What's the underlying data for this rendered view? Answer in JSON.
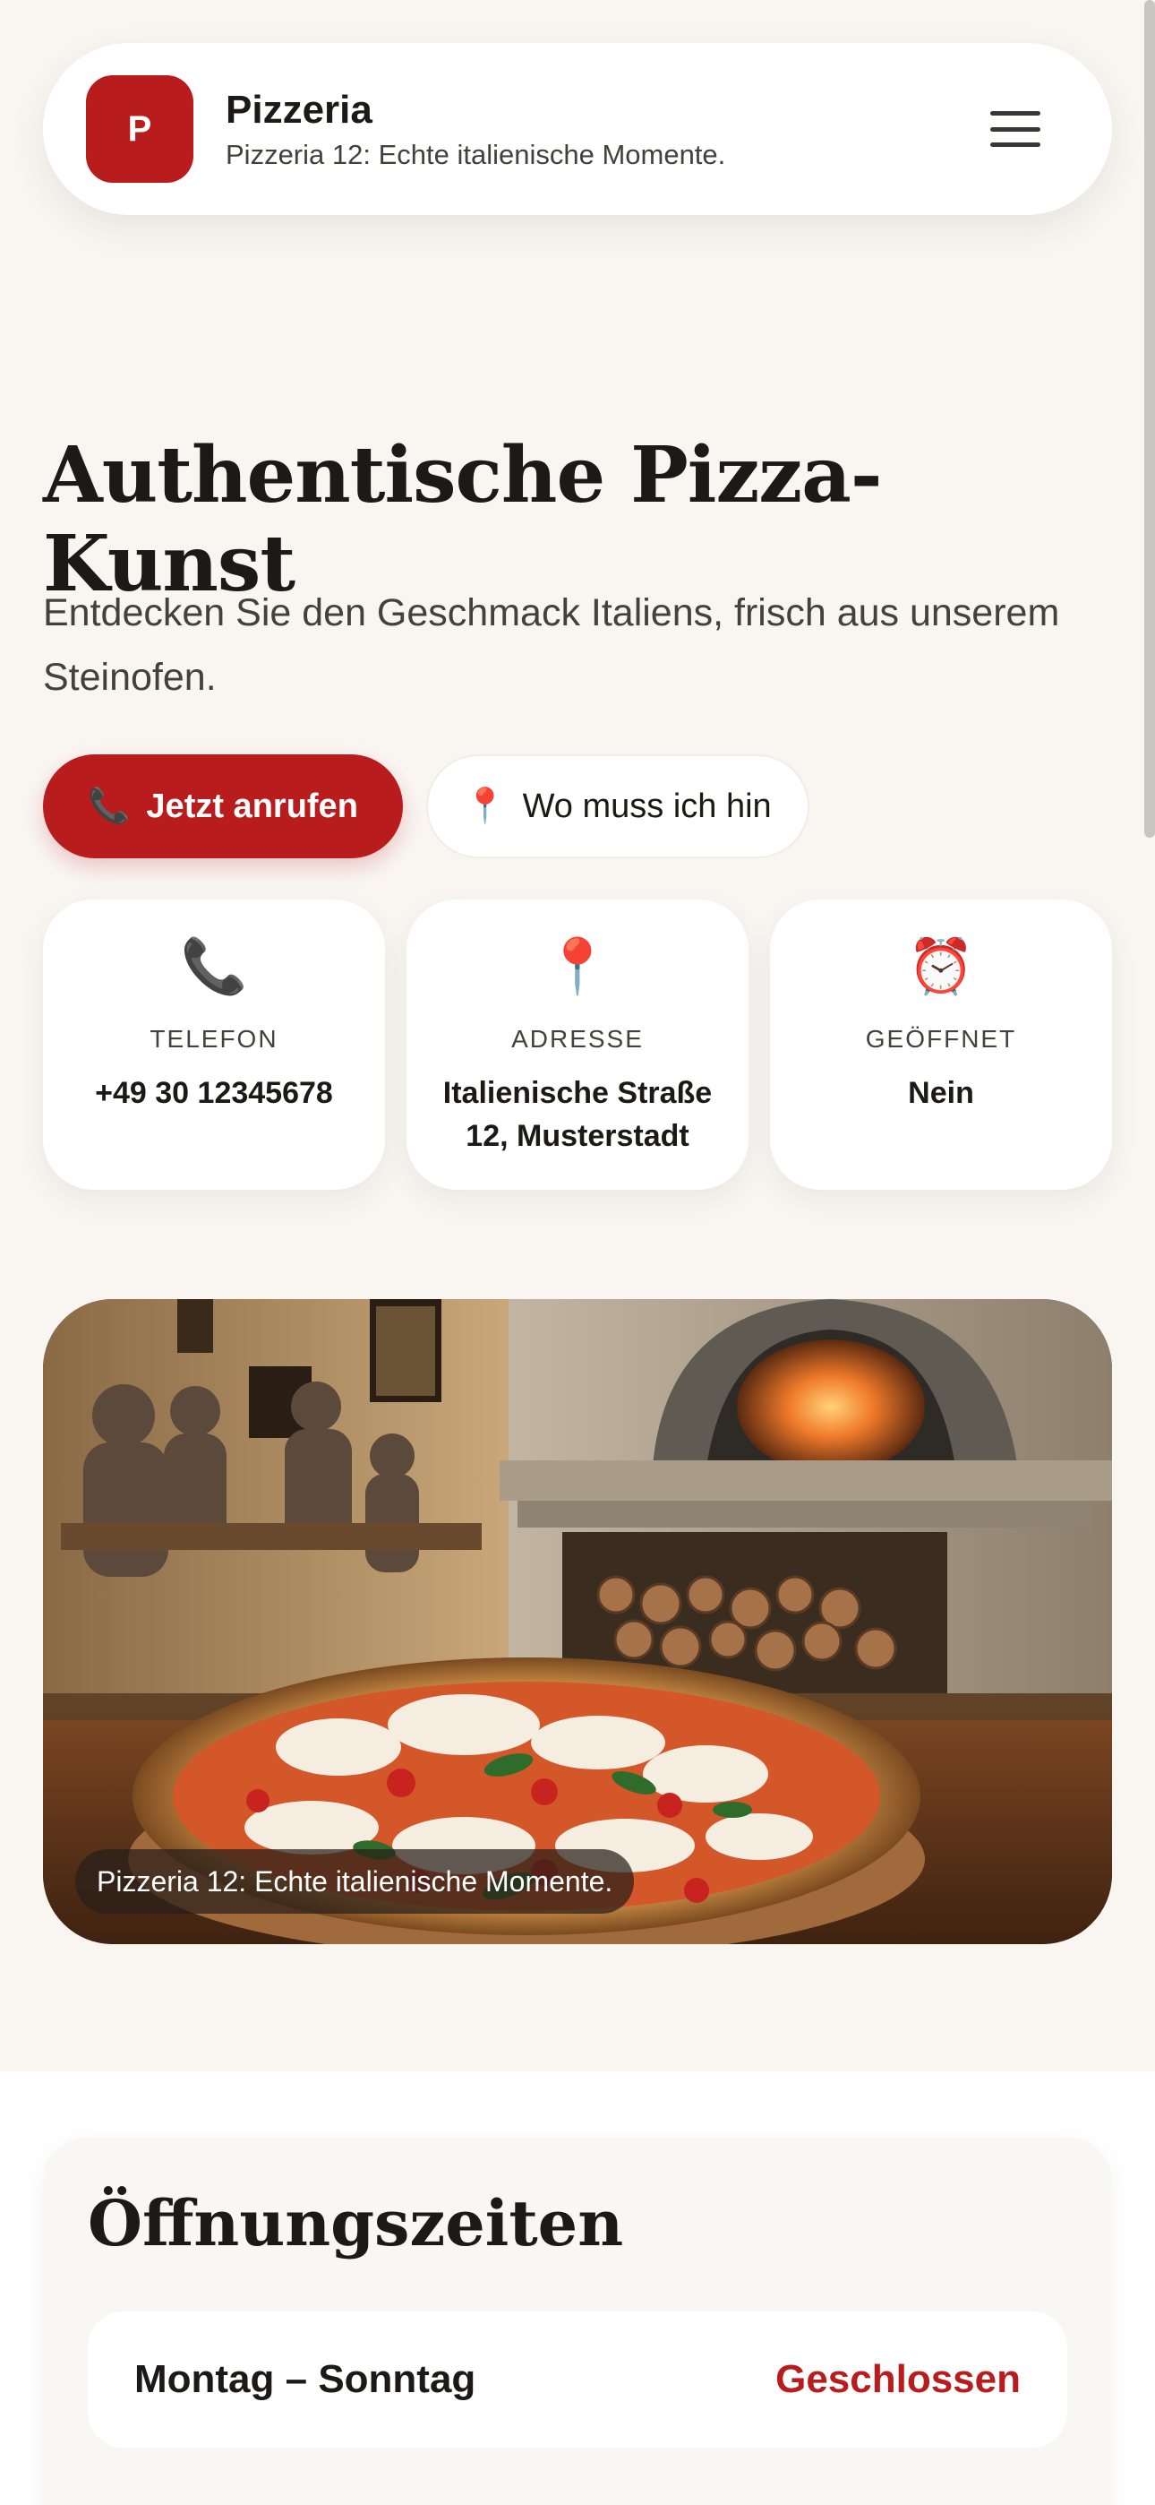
{
  "header": {
    "logo_letter": "P",
    "brand_name": "Pizzeria",
    "tagline": "Pizzeria 12: Echte italienische Momente."
  },
  "hero": {
    "title": "Authentische Pizza-Kunst",
    "subtitle": "Entdecken Sie den Geschmack Italiens, frisch aus unserem Steinofen.",
    "call_button": {
      "icon": "📞",
      "label": "Jetzt anrufen"
    },
    "where_button": {
      "icon": "📍",
      "label": "Wo muss ich hin"
    }
  },
  "info_cards": [
    {
      "icon": "📞",
      "label": "TELEFON",
      "value": "+49 30 12345678"
    },
    {
      "icon": "📍",
      "label": "ADRESSE",
      "value": "Italienische Straße 12, Musterstadt"
    },
    {
      "icon": "⏰",
      "label": "GEÖFFNET",
      "value": "Nein"
    }
  ],
  "photo": {
    "caption": "Pizzeria 12: Echte italienische Momente."
  },
  "opening_hours": {
    "title": "Öffnungszeiten",
    "rows": [
      {
        "days": "Montag – Sonntag",
        "status": "Geschlossen"
      }
    ]
  },
  "colors": {
    "accent": "#b91c1c",
    "background": "#f9f6f2",
    "card": "#ffffff"
  }
}
